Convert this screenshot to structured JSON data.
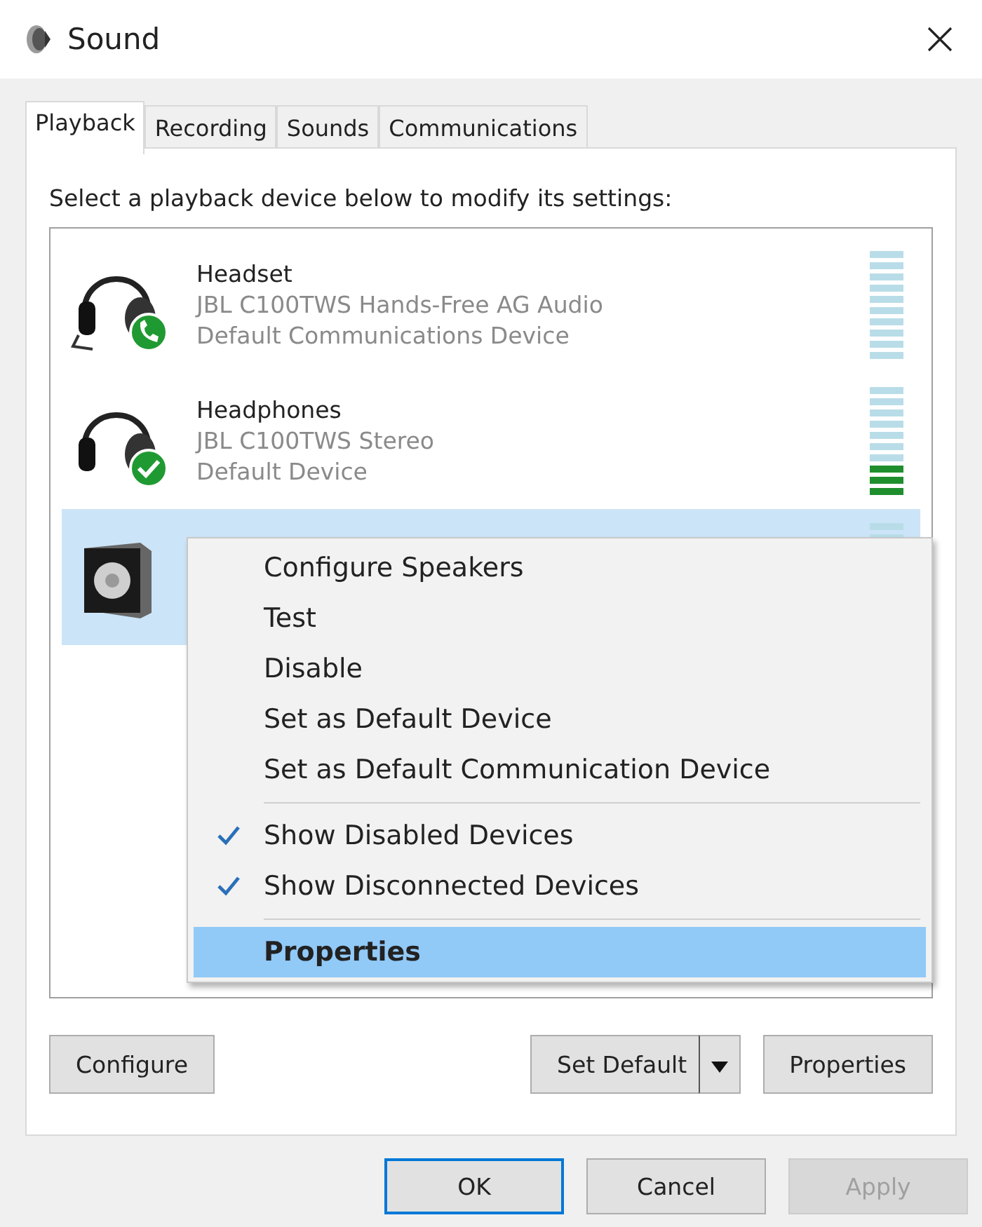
{
  "window": {
    "title": "Sound"
  },
  "tabs": [
    {
      "label": "Playback",
      "selected": true
    },
    {
      "label": "Recording",
      "selected": false
    },
    {
      "label": "Sounds",
      "selected": false
    },
    {
      "label": "Communications",
      "selected": false
    }
  ],
  "instruction": "Select a playback device below to modify its settings:",
  "devices": [
    {
      "kind": "headset_comm",
      "name": "Headset",
      "model": "JBL C100TWS Hands-Free AG Audio",
      "status": "Default Communications Device",
      "selected": false
    },
    {
      "kind": "headset_default",
      "name": "Headphones",
      "model": "JBL C100TWS Stereo",
      "status": "Default Device",
      "level": 0.3,
      "selected": false
    },
    {
      "kind": "speaker",
      "selected": true
    }
  ],
  "context_menu": [
    {
      "kind": "item",
      "label": "Configure Speakers",
      "checked": false,
      "selected": false
    },
    {
      "kind": "item",
      "label": "Test",
      "checked": false,
      "selected": false
    },
    {
      "kind": "item",
      "label": "Disable",
      "checked": false,
      "selected": false
    },
    {
      "kind": "item",
      "label": "Set as Default Device",
      "checked": false,
      "selected": false
    },
    {
      "kind": "item",
      "label": "Set as Default Communication Device",
      "checked": false,
      "selected": false
    },
    {
      "kind": "separator"
    },
    {
      "kind": "item",
      "label": "Show Disabled Devices",
      "checked": true,
      "selected": false
    },
    {
      "kind": "item",
      "label": "Show Disconnected Devices",
      "checked": true,
      "selected": false
    },
    {
      "kind": "separator"
    },
    {
      "kind": "item",
      "label": "Properties",
      "checked": false,
      "selected": true
    }
  ],
  "panel_buttons": {
    "configure": "Configure",
    "set_default": "Set Default",
    "properties": "Properties"
  },
  "dialog_buttons": [
    {
      "label": "OK",
      "focused": true,
      "disabled": false
    },
    {
      "label": "Cancel",
      "focused": false,
      "disabled": false
    },
    {
      "label": "Apply",
      "focused": false,
      "disabled": true
    }
  ]
}
